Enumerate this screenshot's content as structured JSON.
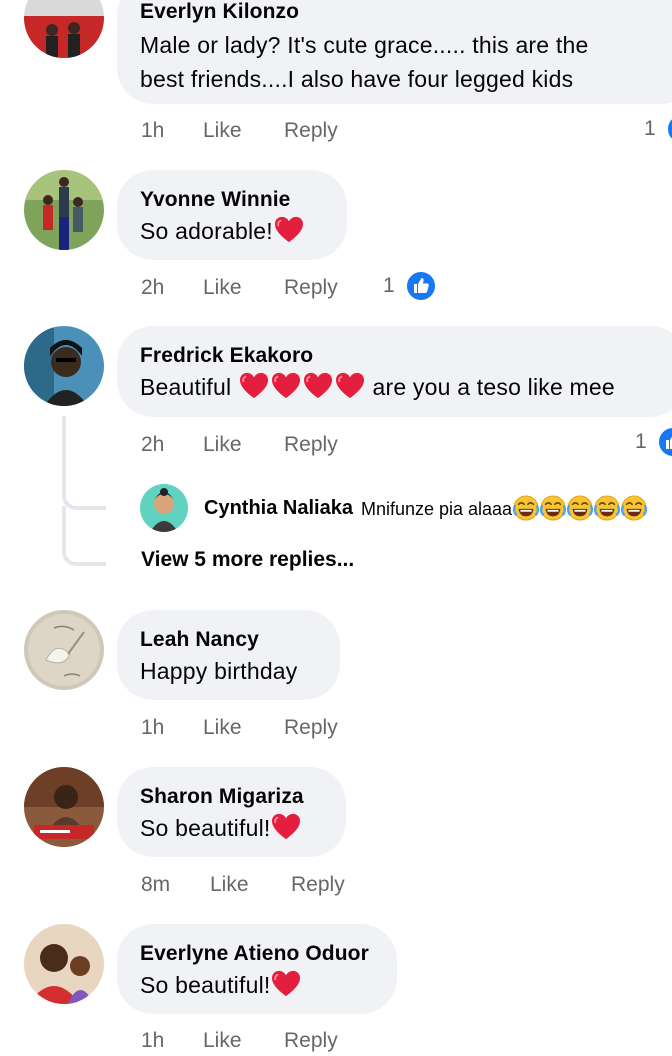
{
  "comments": [
    {
      "name": "Everlyn Kilonzo",
      "text_line1": "Male or lady? It's cute grace..... this are the",
      "text_line2": "best friends....I also have four legged kids",
      "time": "1h",
      "like_label": "Like",
      "reply_label": "Reply",
      "reaction_count": "1"
    },
    {
      "name": "Yvonne Winnie",
      "text": "So adorable!",
      "time": "2h",
      "like_label": "Like",
      "reply_label": "Reply",
      "reaction_count": "1"
    },
    {
      "name": "Fredrick Ekakoro",
      "text_before": "Beautiful",
      "text_after": "are you a teso like mee",
      "time": "2h",
      "like_label": "Like",
      "reply_label": "Reply",
      "reaction_count": "1",
      "reply_preview": {
        "name": "Cynthia Naliaka",
        "text": "Mnifunze pia alaaa"
      },
      "view_more": "View 5 more replies..."
    },
    {
      "name": "Leah Nancy",
      "text": "Happy birthday",
      "time": "1h",
      "like_label": "Like",
      "reply_label": "Reply"
    },
    {
      "name": "Sharon Migariza",
      "text": "So beautiful!",
      "time": "8m",
      "like_label": "Like",
      "reply_label": "Reply"
    },
    {
      "name": "Everlyne Atieno Oduor",
      "text": "So beautiful!",
      "time": "1h",
      "like_label": "Like",
      "reply_label": "Reply"
    }
  ],
  "colors": {
    "bubble": "#f0f2f5",
    "meta_text": "#65676b",
    "like_blue": "#1877f2",
    "heart_red": "#e0245e"
  },
  "icons": [
    "heart-emoji-icon",
    "like-reaction-icon",
    "laughing-emoji-icon"
  ]
}
